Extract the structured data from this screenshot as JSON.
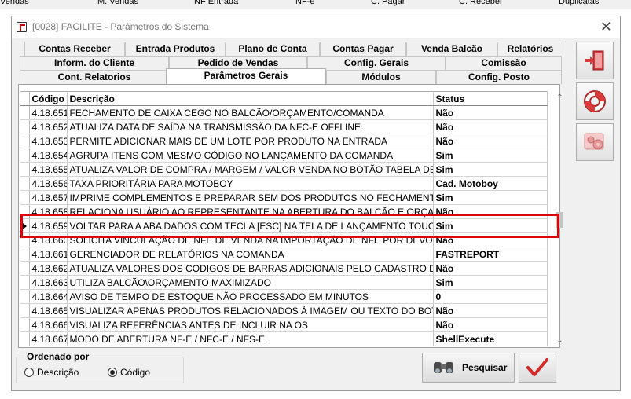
{
  "background_menu": [
    "Vendas",
    "M. Vendas",
    "NF Entrada",
    "NF-e",
    "C. Pagar",
    "C. Receber",
    "Duplicatas"
  ],
  "window": {
    "title": "[0028] FACILITE - Parâmetros do Sistema",
    "close_glyph": "✕"
  },
  "tabs": {
    "row1": [
      "Contas Receber",
      "Entrada Produtos",
      "Plano de Conta",
      "Contas Pagar",
      "Venda Balcão",
      "Relatórios"
    ],
    "row2": [
      "Inform. do Cliente",
      "Pedido de Vendas",
      "Config. Gerais",
      "Comissão"
    ],
    "row3": [
      "Cont. Relatorios",
      "Parâmetros Gerais",
      "Módulos",
      "Config. Posto"
    ],
    "active": "Parâmetros Gerais"
  },
  "grid": {
    "columns": [
      "Código",
      "Descrição",
      "Status"
    ],
    "rows": [
      {
        "code": "4.18.651",
        "desc": "FECHAMENTO DE CAIXA CEGO NO BALCÃO/ORÇAMENTO/COMANDA",
        "status": "Não"
      },
      {
        "code": "4.18.652",
        "desc": "ATUALIZA DATA DE SAÍDA NA TRANSMISSÃO DA NFC-E OFFLINE",
        "status": "Não"
      },
      {
        "code": "4.18.653",
        "desc": "PERMITE ADICIONAR MAIS DE UM LOTE POR PRODUTO NA ENTRADA",
        "status": "Não"
      },
      {
        "code": "4.18.654",
        "desc": "AGRUPA ITENS COM MESMO CÓDIGO NO LANÇAMENTO DA COMANDA",
        "status": "Sim"
      },
      {
        "code": "4.18.655",
        "desc": "ATUALIZA VALOR DE COMPRA / MARGEM / VALOR VENDA NO BOTÃO TABELA DE PREÇO",
        "status": "Sim"
      },
      {
        "code": "4.18.656",
        "desc": "TAXA PRIORITÁRIA PARA MOTOBOY",
        "status": "Cad. Motoboy"
      },
      {
        "code": "4.18.657",
        "desc": "IMPRIME COMPLEMENTOS E PREPARAR SEM DOS PRODUTOS NO FECHAMENTO E FINALIZAÇÃO",
        "status": "Sim"
      },
      {
        "code": "4.18.658",
        "desc": "RELACIONA USUÁRIO AO REPRESENTANTE NA ABERTURA DO BALCÃO E ORÇAMENTO",
        "status": "Não"
      },
      {
        "code": "4.18.659",
        "desc": "VOLTAR PARA A ABA DADOS COM TECLA [ESC] NA TELA DE LANÇAMENTO TOUCH",
        "status": "Sim",
        "selected": true
      },
      {
        "code": "4.18.660",
        "desc": "SOLICITA VINCULAÇÃO DE NFE DE VENDA NA IMPORTAÇÃO DE NFE POR DEVOLUÇÃO DE",
        "status": "Não"
      },
      {
        "code": "4.18.661",
        "desc": "GERENCIADOR DE RELATÓRIOS NA COMANDA",
        "status": "FASTREPORT"
      },
      {
        "code": "4.18.662",
        "desc": "ATUALIZA VALORES DOS CODIGOS DE BARRAS ADICIONAIS PELO CADASTRO DE PRODUTO",
        "status": "Não"
      },
      {
        "code": "4.18.663",
        "desc": "UTILIZA BALCÃO\\ORÇAMENTO MAXIMIZADO",
        "status": "Sim"
      },
      {
        "code": "4.18.664",
        "desc": "AVISO DE TEMPO DE ESTOQUE NÃO PROCESSADO EM MINUTOS",
        "status": "0"
      },
      {
        "code": "4.18.665",
        "desc": "VISUALIZAR APENAS PRODUTOS RELACIONADOS À IMAGEM OU TEXTO DO BOTÃO NA COMANDA",
        "status": "Não"
      },
      {
        "code": "4.18.666",
        "desc": "VISUALIZA REFERÊNCIAS ANTES DE INCLUIR NA OS",
        "status": "Não"
      },
      {
        "code": "4.18.667",
        "desc": "MODO DE ABERTURA NF-E / NFC-E / NFS-E",
        "status": "ShellExecute"
      }
    ]
  },
  "order": {
    "legend": "Ordenado por",
    "options": [
      "Descrição",
      "Código"
    ],
    "selected": "Código"
  },
  "buttons": {
    "search": "Pesquisar"
  },
  "side_icons": [
    "exit-door-icon",
    "lifebuoy-icon",
    "settings-gears-icon"
  ],
  "colors": {
    "highlight": "#e00000",
    "accent_red": "#d42a2a"
  }
}
